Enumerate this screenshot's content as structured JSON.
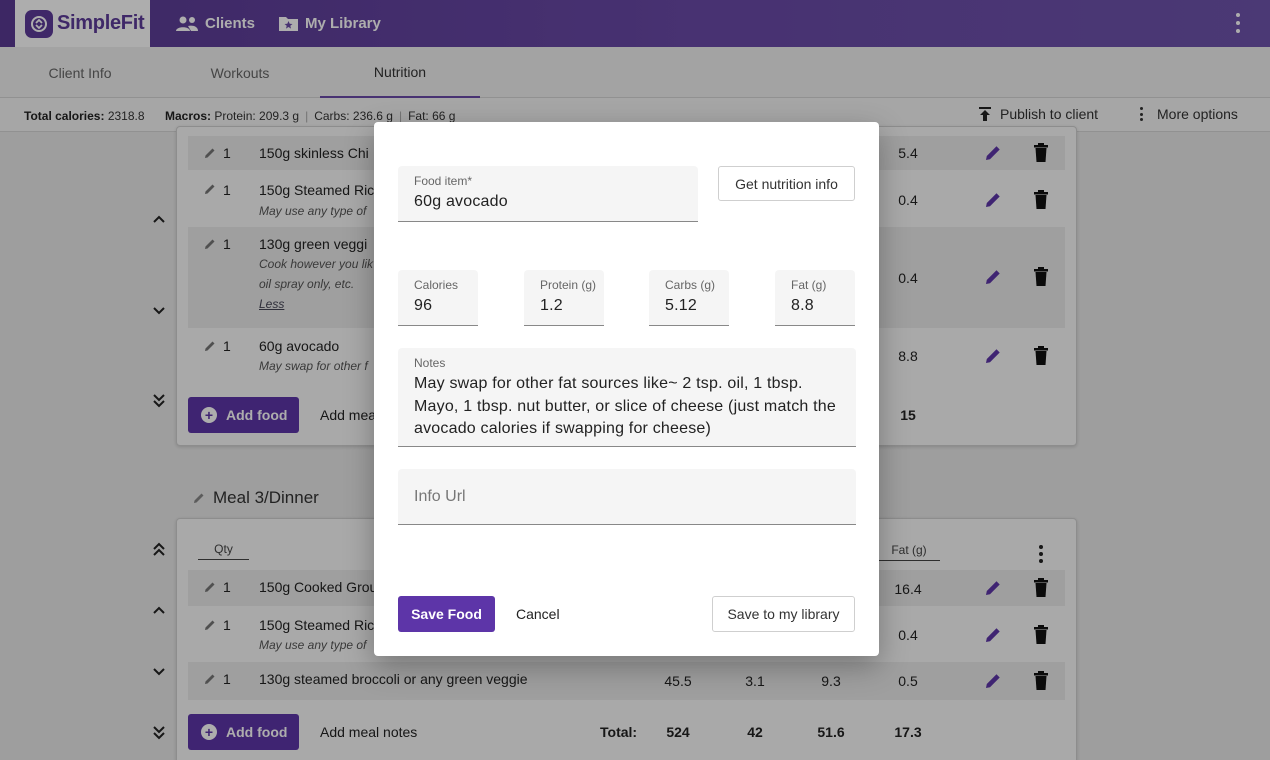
{
  "app": {
    "name": "SimpleFit"
  },
  "nav": {
    "clients": "Clients",
    "library": "My Library"
  },
  "tabs": [
    "Client Info",
    "Workouts",
    "Nutrition"
  ],
  "summary": {
    "total_label": "Total calories:",
    "total_value": "2318.8",
    "macros_label": "Macros:",
    "protein": "Protein: 209.3 g",
    "carbs": "Carbs: 236.6 g",
    "fat": "Fat: 66 g",
    "publish": "Publish to client",
    "more": "More options"
  },
  "meal2": {
    "rows": [
      {
        "qty": "1",
        "name": "150g skinless Chi",
        "fat": "5.4"
      },
      {
        "qty": "1",
        "name": "150g Steamed Ric",
        "note": "May use any type of",
        "fat": "0.4"
      },
      {
        "qty": "1",
        "name": "130g green veggi",
        "note": "Cook however you lik",
        "note2": "oil spray only, etc.",
        "less": "Less",
        "fat": "0.4"
      },
      {
        "qty": "1",
        "name": "60g avocado",
        "note": "May swap for other f",
        "fat": "8.8"
      }
    ],
    "add_food": "Add food",
    "add_meal": "Add mea",
    "fat_total": "15"
  },
  "meal3": {
    "title": "Meal 3/Dinner",
    "qty_header": "Qty",
    "fat_header": "Fat (g)",
    "rows": [
      {
        "qty": "1",
        "name": "150g Cooked Grou",
        "fat": "16.4"
      },
      {
        "qty": "1",
        "name": "150g Steamed Ric",
        "note": "May use any type of",
        "fat": "0.4"
      },
      {
        "qty": "1",
        "name": "130g steamed broccoli or any green veggie",
        "cal": "45.5",
        "protein": "3.1",
        "carbs": "9.3",
        "fat": "0.5"
      }
    ],
    "add_food": "Add food",
    "add_meal_notes": "Add meal notes",
    "total_label": "Total:",
    "total_cal": "524",
    "total_protein": "42",
    "total_carbs": "51.6",
    "total_fat": "17.3"
  },
  "dialog": {
    "food_label": "Food item*",
    "food_value": "60g avocado",
    "get_info": "Get nutrition info",
    "cal_label": "Calories",
    "cal_value": "96",
    "protein_label": "Protein (g)",
    "protein_value": "1.2",
    "carbs_label": "Carbs (g)",
    "carbs_value": "5.12",
    "fat_label": "Fat (g)",
    "fat_value": "8.8",
    "notes_label": "Notes",
    "notes_value": "May swap for other fat sources like~ 2 tsp. oil, 1 tbsp. Mayo, 1 tbsp. nut butter, or slice of cheese (just match the avocado calories if swapping for cheese)",
    "info_url_placeholder": "Info Url",
    "save": "Save Food",
    "cancel": "Cancel",
    "save_library": "Save to my library"
  },
  "colors": {
    "brand": "#5d35a8",
    "bar": "#6a4aa8"
  }
}
